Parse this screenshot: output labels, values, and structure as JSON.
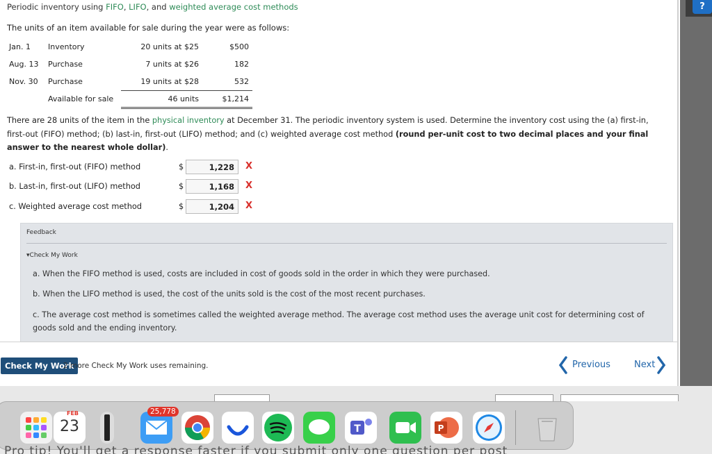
{
  "header": {
    "title_prefix": "Periodic inventory using ",
    "fifo": "FIFO",
    "sep1": ", ",
    "lifo": "LIFO",
    "sep2": ", and ",
    "wac": "weighted average cost methods",
    "help_icon": "?"
  },
  "intro": "The units of an item available for sale during the year were as follows:",
  "inventory_table": [
    {
      "date": "Jan. 1",
      "desc": "Inventory",
      "units": "20 units at $25",
      "cost": "$500"
    },
    {
      "date": "Aug. 13",
      "desc": "Purchase",
      "units": "7 units at $26",
      "cost": "182"
    },
    {
      "date": "Nov. 30",
      "desc": "Purchase",
      "units": "19 units at $28",
      "cost": "532"
    },
    {
      "date": "",
      "desc": "Available for sale",
      "units": "46 units",
      "cost": "$1,214"
    }
  ],
  "problem": {
    "p1": "There are 28 units of the item in the ",
    "link": "physical inventory",
    "p2": " at December 31. The periodic inventory system is used. Determine the inventory cost using the (a) first-in, first-out (FIFO) method; (b) last-in, first-out (LIFO) method; and (c) weighted average cost method ",
    "bold": "(round per-unit cost to two decimal places and your final answer to the nearest whole dollar)",
    "end": "."
  },
  "answers": [
    {
      "label": "a. First-in, first-out (FIFO) method",
      "dollar": "$",
      "value": "1,228",
      "mark": "X"
    },
    {
      "label": "b. Last-in, first-out (LIFO) method",
      "dollar": "$",
      "value": "1,168",
      "mark": "X"
    },
    {
      "label": "c. Weighted average cost method",
      "dollar": "$",
      "value": "1,204",
      "mark": "X"
    }
  ],
  "feedback": {
    "title": "Feedback",
    "check_label": "Check My Work",
    "items": [
      "a. When the FIFO method is used, costs are included in cost of goods sold in the order in which they were purchased.",
      "b. When the LIFO method is used, the cost of the units sold is the cost of the most recent purchases.",
      "c. The average cost method is sometimes called the weighted average method. The average cost method uses the average unit cost for determining cost of goods sold and the ending inventory."
    ]
  },
  "footer": {
    "check_button": "Check My Work",
    "remaining": "2 more Check My Work uses remaining.",
    "previous": "Previous",
    "next": "Next"
  },
  "dock": {
    "calendar_month": "FEB",
    "calendar_day": "23",
    "mail_badge": "25,778",
    "icons": [
      "launchpad-icon",
      "calendar-icon",
      "audio-icon",
      "mail-icon",
      "chrome-icon",
      "webex-icon",
      "spotify-icon",
      "messages-icon",
      "teams-icon",
      "facetime-icon",
      "powerpoint-icon",
      "safari-icon",
      "trash-icon"
    ]
  },
  "bottom_strip": {
    "text": "Pro tip! You'll get a response faster if you submit only one question per post"
  },
  "colors": {
    "link": "#2e8b57",
    "x_mark": "#d9302c",
    "button": "#1f4e79",
    "nav": "#2266aa",
    "feedback_bg": "#e1e4e8"
  }
}
